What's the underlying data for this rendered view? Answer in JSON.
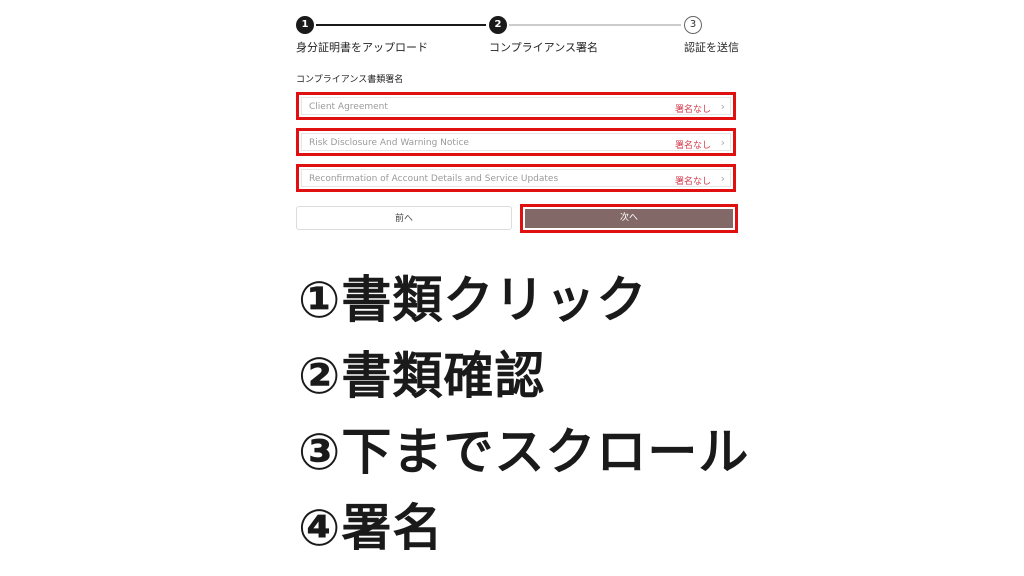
{
  "stepper": {
    "steps": [
      {
        "number": "1",
        "label": "身分証明書をアップロード",
        "state": "done"
      },
      {
        "number": "2",
        "label": "コンプライアンス署名",
        "state": "current"
      },
      {
        "number": "3",
        "label": "認証を送信",
        "state": "todo"
      }
    ],
    "colors": {
      "active": "#1a1a1a",
      "inactive": "#cccccc"
    }
  },
  "section": {
    "title": "コンプライアンス書類署名"
  },
  "documents": [
    {
      "name": "Client Agreement",
      "status": "署名なし"
    },
    {
      "name": "Risk Disclosure And Warning Notice",
      "status": "署名なし"
    },
    {
      "name": "Reconfirmation of Account Details and Service Updates",
      "status": "署名なし"
    }
  ],
  "buttons": {
    "prev_label": "前へ",
    "next_label": "次へ"
  },
  "instructions": [
    "①書類クリック",
    "②書類確認",
    "③下までスクロール",
    "④署名"
  ],
  "colors": {
    "highlight": "#e01010",
    "status_text": "#d23a4a",
    "next_button": "#836868"
  }
}
